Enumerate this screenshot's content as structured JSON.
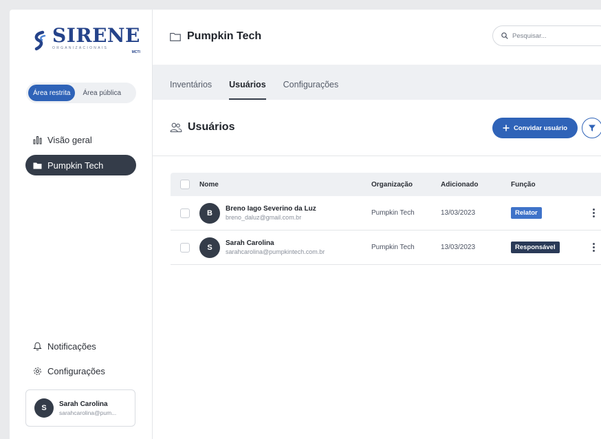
{
  "brand": {
    "name": "SIRENE",
    "subtitle": "ORGANIZACIONAIS",
    "ministry": "MCTI",
    "primary_color": "#2f63b8",
    "dark_color": "#343c49"
  },
  "sidebar": {
    "area_toggle": {
      "restricted": "Área restrita",
      "public": "Área pública",
      "selected": "restricted"
    },
    "nav": [
      {
        "label": "Visão geral",
        "icon": "bar-chart-icon",
        "active": false
      },
      {
        "label": "Pumpkin Tech",
        "icon": "folder-icon",
        "active": true
      }
    ],
    "footer_nav": [
      {
        "label": "Notificações",
        "icon": "bell-icon"
      },
      {
        "label": "Configurações",
        "icon": "gear-icon"
      }
    ],
    "user": {
      "initial": "S",
      "name": "Sarah Carolina",
      "email": "sarahcarolina@pum..."
    }
  },
  "header": {
    "org_title": "Pumpkin Tech",
    "search_placeholder": "Pesquisar..."
  },
  "tabs": [
    {
      "label": "Inventários",
      "active": false
    },
    {
      "label": "Usuários",
      "active": true
    },
    {
      "label": "Configurações",
      "active": false
    }
  ],
  "section": {
    "title": "Usuários",
    "invite_label": "Convidar usuário"
  },
  "table": {
    "columns": [
      "Nome",
      "Organização",
      "Adicionado",
      "Função"
    ],
    "rows": [
      {
        "initial": "B",
        "name": "Breno Iago Severino da Luz",
        "email": "breno_daluz@gmail.com.br",
        "organization": "Pumpkin Tech",
        "added": "13/03/2023",
        "role": "Relator",
        "role_color": "#3f73c9"
      },
      {
        "initial": "S",
        "name": "Sarah Carolina",
        "email": "sarahcarolina@pumpkintech.com.br",
        "organization": "Pumpkin Tech",
        "added": "13/03/2023",
        "role": "Responsável",
        "role_color": "#2a3a57"
      }
    ]
  }
}
